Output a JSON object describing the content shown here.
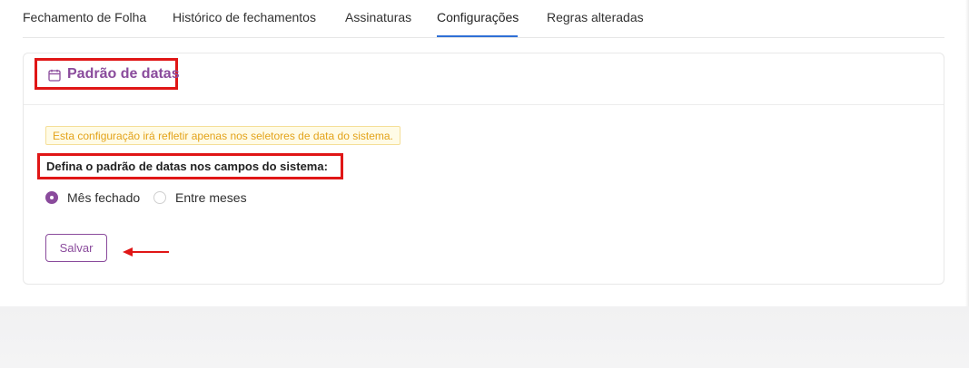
{
  "tabs": [
    {
      "label": "Fechamento de Folha",
      "active": false
    },
    {
      "label": "Histórico de fechamentos",
      "active": false
    },
    {
      "label": "Assinaturas",
      "active": false
    },
    {
      "label": "Configurações",
      "active": true
    },
    {
      "label": "Regras alteradas",
      "active": false
    }
  ],
  "card": {
    "icon": "calendar-icon",
    "title": "Padrão de datas",
    "notice": "Esta configuração irá refletir apenas nos seletores de data do sistema.",
    "question": "Defina o padrão de datas nos campos do sistema:",
    "options": [
      {
        "label": "Mês fechado",
        "selected": true
      },
      {
        "label": "Entre meses",
        "selected": false
      }
    ],
    "save_label": "Salvar"
  },
  "colors": {
    "accent": "#8a4b9c",
    "active_tab": "#2f6fd6",
    "notice_text": "#e3a31a",
    "annotation": "#e01616"
  }
}
